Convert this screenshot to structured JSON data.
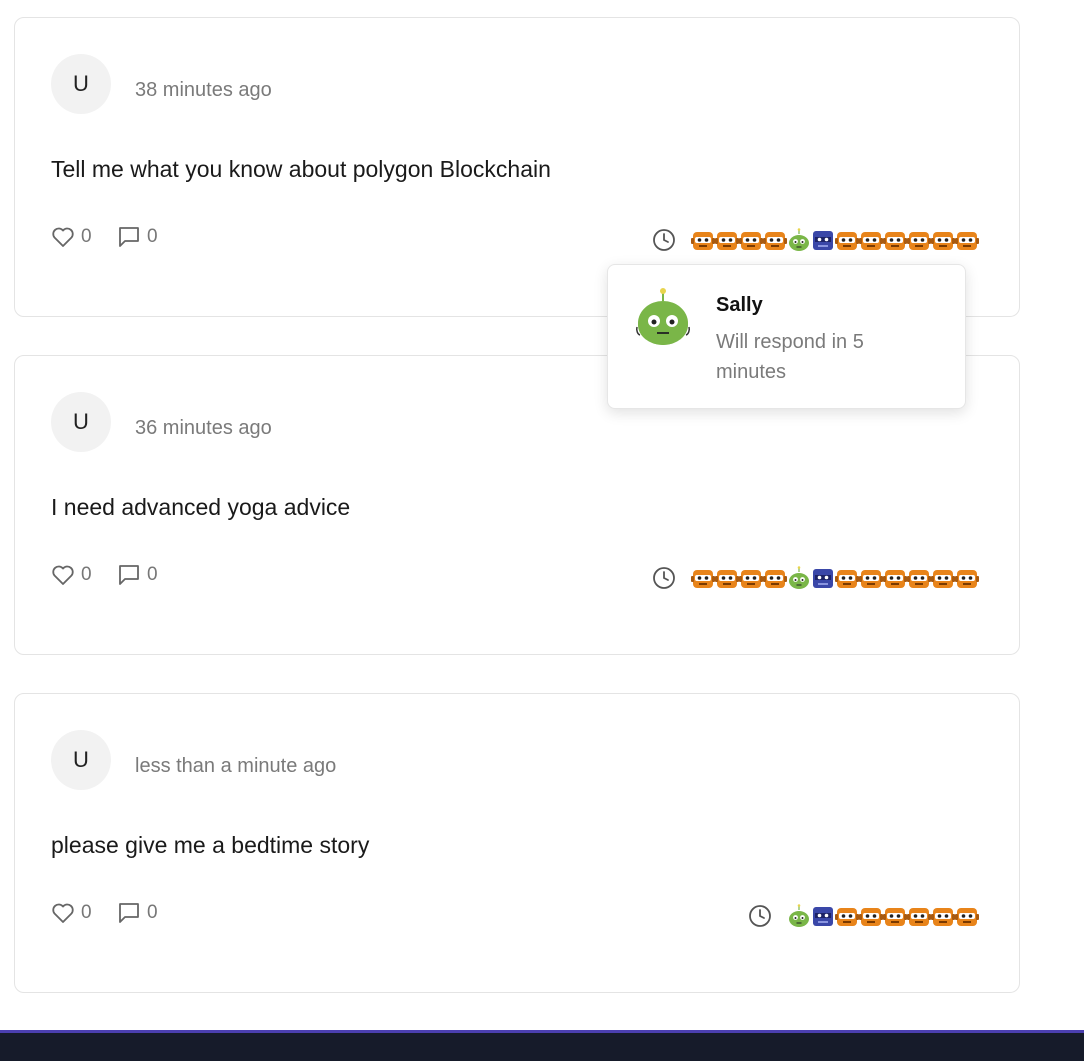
{
  "posts": [
    {
      "avatar_initial": "U",
      "time": "38 minutes ago",
      "content": "Tell me what you know about polygon Blockchain",
      "likes": "0",
      "comments": "0",
      "queue": [
        "orange",
        "orange",
        "orange",
        "orange",
        "green",
        "blue",
        "orange",
        "orange",
        "orange",
        "orange",
        "orange",
        "orange"
      ]
    },
    {
      "avatar_initial": "U",
      "time": "36 minutes ago",
      "content": "I need advanced yoga advice",
      "likes": "0",
      "comments": "0",
      "queue": [
        "orange",
        "orange",
        "orange",
        "orange",
        "green",
        "blue",
        "orange",
        "orange",
        "orange",
        "orange",
        "orange",
        "orange"
      ]
    },
    {
      "avatar_initial": "U",
      "time": "less than a minute ago",
      "content": "please give me a bedtime story",
      "likes": "0",
      "comments": "0",
      "queue": [
        "green",
        "blue",
        "orange",
        "orange",
        "orange",
        "orange",
        "orange",
        "orange"
      ]
    }
  ],
  "popover": {
    "name": "Sally",
    "message": "Will respond in 5 minutes",
    "icon": "robot-green-icon"
  },
  "colors": {
    "robot_orange": "#e8841a",
    "robot_green": "#7ab648",
    "robot_blue": "#3a47a8",
    "bottom_bar": "#161b2a",
    "bottom_bar_accent": "#4b3fb0"
  }
}
